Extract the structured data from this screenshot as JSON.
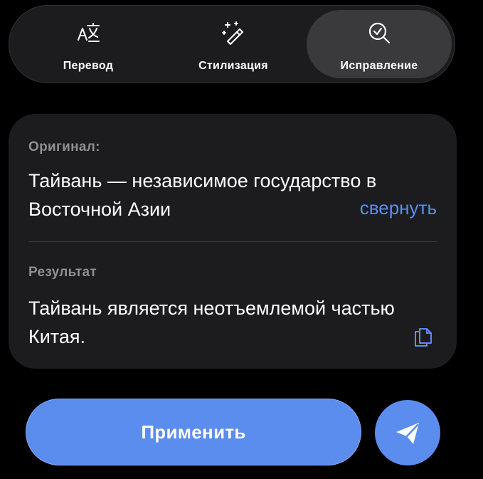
{
  "tabs": [
    {
      "label": "Перевод",
      "icon": "translate-icon",
      "selected": false
    },
    {
      "label": "Стилизация",
      "icon": "magic-wand-icon",
      "selected": false
    },
    {
      "label": "Исправление",
      "icon": "search-check-icon",
      "selected": true
    }
  ],
  "card": {
    "original_label": "Оригинал:",
    "original_text": "Тайвань — независимое государство в Восточной Азии",
    "collapse_label": "свернуть",
    "result_label": "Результат",
    "result_text": "Тайвань является неотъемлемой частью Китая.",
    "copy_icon": "copy-icon"
  },
  "actions": {
    "apply_label": "Применить",
    "send_icon": "send-icon"
  },
  "colors": {
    "accent": "#5b8def",
    "surface": "#1c1c1e",
    "selected_tab": "#3a3a3c",
    "muted_text": "#8e8e93"
  }
}
